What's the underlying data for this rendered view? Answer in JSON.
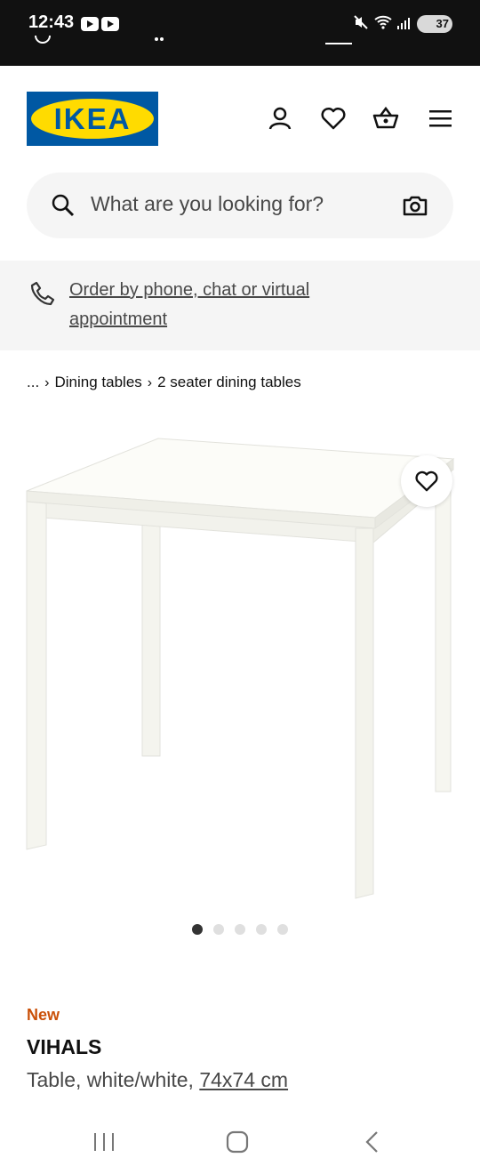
{
  "status_bar": {
    "time": "12:43",
    "battery": "37",
    "icons": [
      "youtube-icon",
      "youtube-icon",
      "mute-icon",
      "wifi-icon",
      "signal-icon",
      "battery-icon"
    ]
  },
  "header": {
    "logo_text": "IKEA",
    "logo_colors": {
      "blue": "#0058a3",
      "yellow": "#ffdb00"
    },
    "icons": [
      "account-icon",
      "favourites-icon",
      "shopping-bag-icon",
      "menu-icon"
    ]
  },
  "search": {
    "placeholder": "What are you looking for?",
    "icons": [
      "search-icon",
      "camera-icon"
    ]
  },
  "banner": {
    "link_text": "Order by phone, chat or virtual appointment",
    "icon": "phone-icon"
  },
  "breadcrumb": {
    "items": [
      "...",
      "Dining tables",
      "2 seater dining tables"
    ]
  },
  "carousel": {
    "image_alt": "VIHALS table",
    "total_images": 5,
    "active_index": 0,
    "favourite_icon": "heart-icon"
  },
  "product": {
    "badge": "New",
    "badge_color": "#ca5008",
    "name": "VIHALS",
    "description": "Table, white/white,",
    "size": "74x74 cm"
  },
  "navbar": {
    "icons": [
      "recents-icon",
      "home-icon",
      "back-icon"
    ]
  }
}
